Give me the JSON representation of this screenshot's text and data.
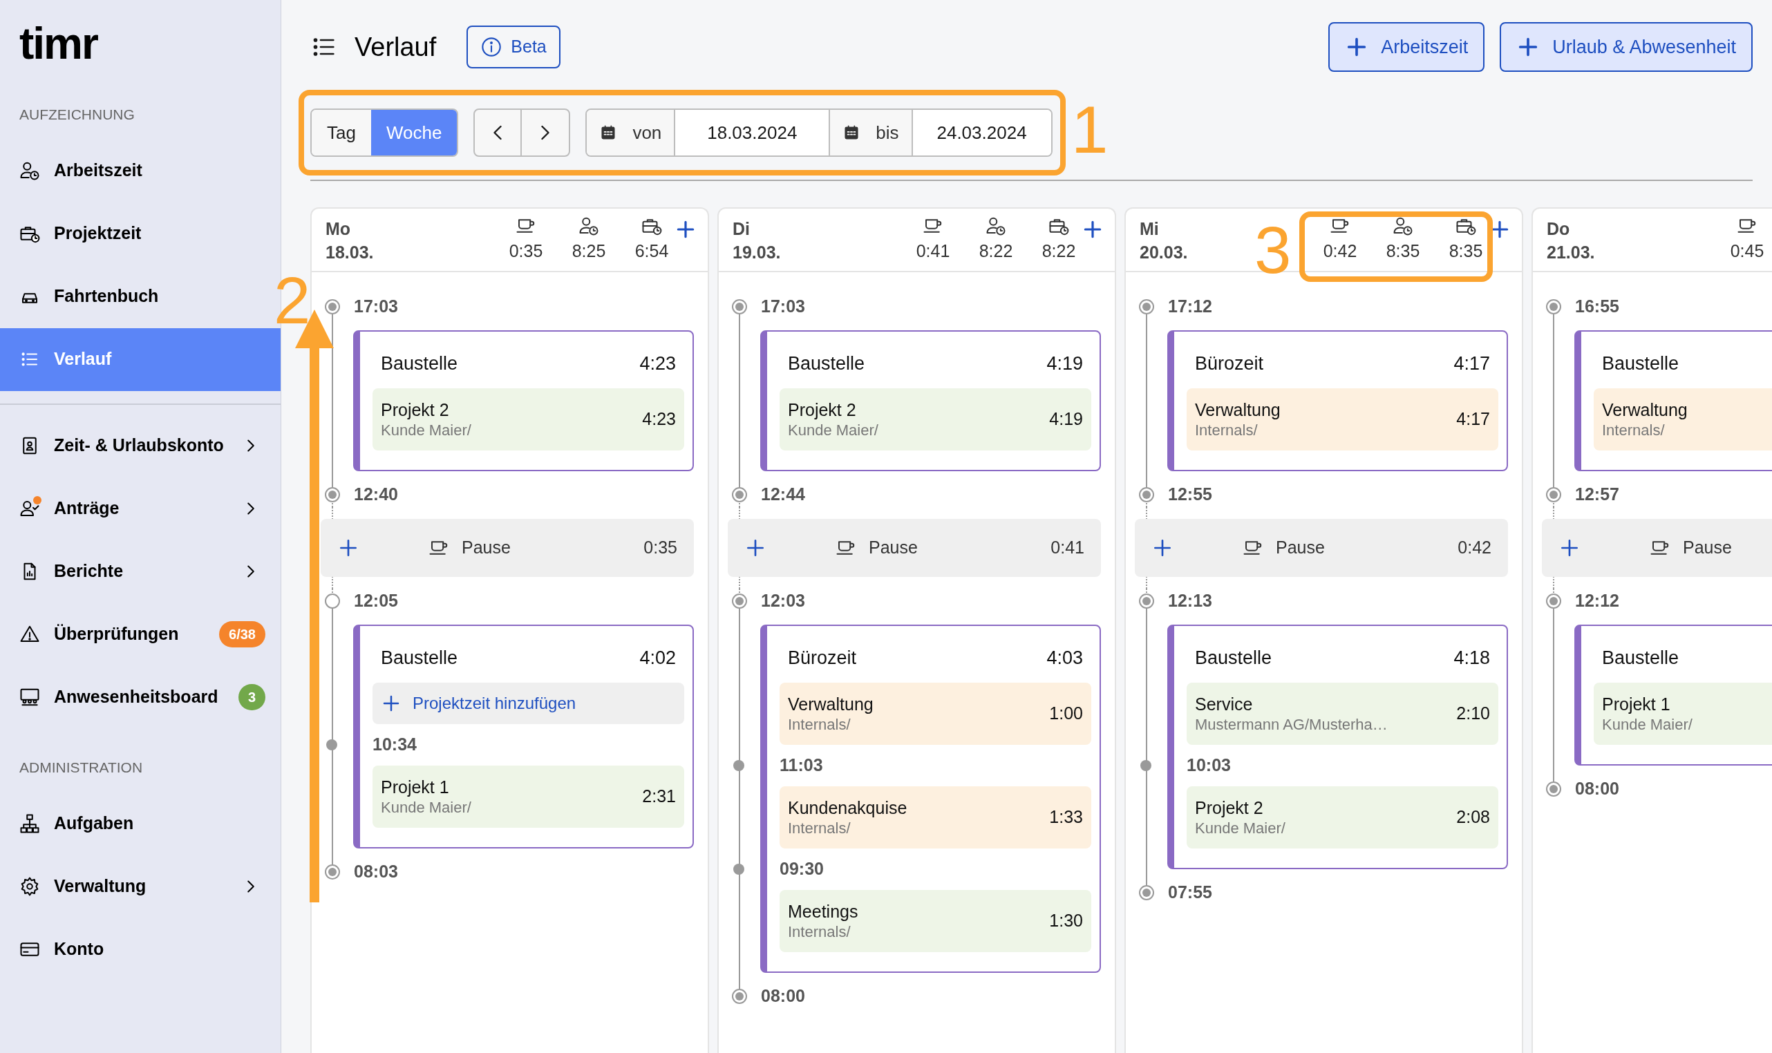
{
  "sidebar": {
    "logo": "timr",
    "groups": [
      {
        "heading": "AUFZEICHNUNG",
        "divider_above": false,
        "items": [
          {
            "label": "Arbeitszeit",
            "selected": false,
            "expandable": false,
            "notification": false
          },
          {
            "label": "Projektzeit",
            "selected": false,
            "expandable": false,
            "notification": false
          },
          {
            "label": "Fahrtenbuch",
            "selected": false,
            "expandable": false,
            "notification": false
          },
          {
            "label": "Verlauf",
            "selected": true,
            "expandable": false,
            "notification": false
          }
        ]
      },
      {
        "divider_above": true,
        "items": [
          {
            "label": "Zeit- & Urlaubskonto",
            "selected": false,
            "expandable": true,
            "notification": false
          },
          {
            "label": "Anträge",
            "selected": false,
            "expandable": true,
            "notification": true
          },
          {
            "label": "Berichte",
            "selected": false,
            "expandable": true,
            "notification": false
          },
          {
            "label": "Überprüfungen",
            "selected": false,
            "expandable": false,
            "notification": false,
            "badge": {
              "text": "6/38",
              "color": "#f5842b"
            }
          },
          {
            "label": "Anwesenheitsboard",
            "selected": false,
            "expandable": false,
            "notification": false,
            "badge": {
              "text": "3",
              "color": "#72a84a"
            }
          }
        ]
      },
      {
        "heading": "ADMINISTRATION",
        "divider_above": false,
        "items": [
          {
            "label": "Aufgaben",
            "selected": false,
            "expandable": false,
            "notification": false
          },
          {
            "label": "Verwaltung",
            "selected": false,
            "expandable": true,
            "notification": false
          },
          {
            "label": "Konto",
            "selected": false,
            "expandable": false,
            "notification": false
          }
        ]
      }
    ]
  },
  "header": {
    "title": "Verlauf",
    "beta_button": "Beta",
    "actions": [
      "Arbeitszeit",
      "Urlaub & Abwesenheit"
    ]
  },
  "toolbar": {
    "tabs": [
      {
        "label": "Tag",
        "selected": false
      },
      {
        "label": "Woche",
        "selected": true
      }
    ],
    "from_label": "von",
    "from": "18.03.2024",
    "to_label": "bis",
    "to": "24.03.2024"
  },
  "annotations": {
    "toolbar_marker": "1",
    "timeline_marker": "2",
    "totals_marker": "3"
  },
  "days": [
    {
      "day": "Mo",
      "date": "18.03.",
      "totals": [
        "0:35",
        "8:25",
        "6:54"
      ],
      "timeline": [
        {
          "kind": "time",
          "time": "17:03",
          "hollow": false
        },
        {
          "kind": "block",
          "title": "Baustelle",
          "duration": "4:23",
          "items": [
            {
              "kind": "project",
              "name": "Projekt 2",
              "client": "Kunde Maier/",
              "duration": "4:23",
              "color": "#eef5e7"
            }
          ]
        },
        {
          "kind": "time",
          "time": "12:40",
          "hollow": false
        },
        {
          "kind": "pause",
          "label": "Pause",
          "duration": "0:35"
        },
        {
          "kind": "time",
          "time": "12:05",
          "hollow": true
        },
        {
          "kind": "block",
          "title": "Baustelle",
          "duration": "4:02",
          "items": [
            {
              "kind": "add",
              "label": "Projektzeit hinzufügen"
            },
            {
              "kind": "time",
              "time": "10:34"
            },
            {
              "kind": "project",
              "name": "Projekt 1",
              "client": "Kunde Maier/",
              "duration": "2:31",
              "color": "#eef5e7"
            }
          ]
        },
        {
          "kind": "time",
          "time": "08:03",
          "hollow": false
        }
      ]
    },
    {
      "day": "Di",
      "date": "19.03.",
      "totals": [
        "0:41",
        "8:22",
        "8:22"
      ],
      "timeline": [
        {
          "kind": "time",
          "time": "17:03",
          "hollow": false
        },
        {
          "kind": "block",
          "title": "Baustelle",
          "duration": "4:19",
          "items": [
            {
              "kind": "project",
              "name": "Projekt 2",
              "client": "Kunde Maier/",
              "duration": "4:19",
              "color": "#eef5e7"
            }
          ]
        },
        {
          "kind": "time",
          "time": "12:44",
          "hollow": false
        },
        {
          "kind": "pause",
          "label": "Pause",
          "duration": "0:41"
        },
        {
          "kind": "time",
          "time": "12:03",
          "hollow": false
        },
        {
          "kind": "block",
          "title": "Bürozeit",
          "duration": "4:03",
          "items": [
            {
              "kind": "project",
              "name": "Verwaltung",
              "client": "Internals/",
              "duration": "1:00",
              "color": "#fdf0df"
            },
            {
              "kind": "time",
              "time": "11:03"
            },
            {
              "kind": "project",
              "name": "Kundenakquise",
              "client": "Internals/",
              "duration": "1:33",
              "color": "#fdf0df"
            },
            {
              "kind": "time",
              "time": "09:30"
            },
            {
              "kind": "project",
              "name": "Meetings",
              "client": "Internals/",
              "duration": "1:30",
              "color": "#eef5e7"
            }
          ]
        },
        {
          "kind": "time",
          "time": "08:00",
          "hollow": false
        }
      ]
    },
    {
      "day": "Mi",
      "date": "20.03.",
      "totals": [
        "0:42",
        "8:35",
        "8:35"
      ],
      "timeline": [
        {
          "kind": "time",
          "time": "17:12",
          "hollow": false
        },
        {
          "kind": "block",
          "title": "Bürozeit",
          "duration": "4:17",
          "items": [
            {
              "kind": "project",
              "name": "Verwaltung",
              "client": "Internals/",
              "duration": "4:17",
              "color": "#fdf0df"
            }
          ]
        },
        {
          "kind": "time",
          "time": "12:55",
          "hollow": false
        },
        {
          "kind": "pause",
          "label": "Pause",
          "duration": "0:42"
        },
        {
          "kind": "time",
          "time": "12:13",
          "hollow": false
        },
        {
          "kind": "block",
          "title": "Baustelle",
          "duration": "4:18",
          "items": [
            {
              "kind": "project",
              "name": "Service",
              "client": "Mustermann AG/Musterha…",
              "duration": "2:10",
              "color": "#eef5e7"
            },
            {
              "kind": "time",
              "time": "10:03"
            },
            {
              "kind": "project",
              "name": "Projekt 2",
              "client": "Kunde Maier/",
              "duration": "2:08",
              "color": "#eef5e7"
            }
          ]
        },
        {
          "kind": "time",
          "time": "07:55",
          "hollow": false
        }
      ]
    },
    {
      "day": "Do",
      "date": "21.03.",
      "totals": [
        "0:45"
      ],
      "timeline": [
        {
          "kind": "time",
          "time": "16:55",
          "hollow": false
        },
        {
          "kind": "block",
          "title": "Baustelle",
          "items": [
            {
              "kind": "project",
              "name": "Verwaltung",
              "client": "Internals/",
              "color": "#fdf0df"
            }
          ]
        },
        {
          "kind": "time",
          "time": "12:57",
          "hollow": false
        },
        {
          "kind": "pause",
          "label": "Pause"
        },
        {
          "kind": "time",
          "time": "12:12",
          "hollow": false
        },
        {
          "kind": "block",
          "title": "Baustelle",
          "items": [
            {
              "kind": "project",
              "name": "Projekt 1",
              "client": "Kunde Maier/",
              "color": "#eef5e7"
            }
          ]
        },
        {
          "kind": "time",
          "time": "08:00",
          "hollow": false
        }
      ]
    }
  ]
}
